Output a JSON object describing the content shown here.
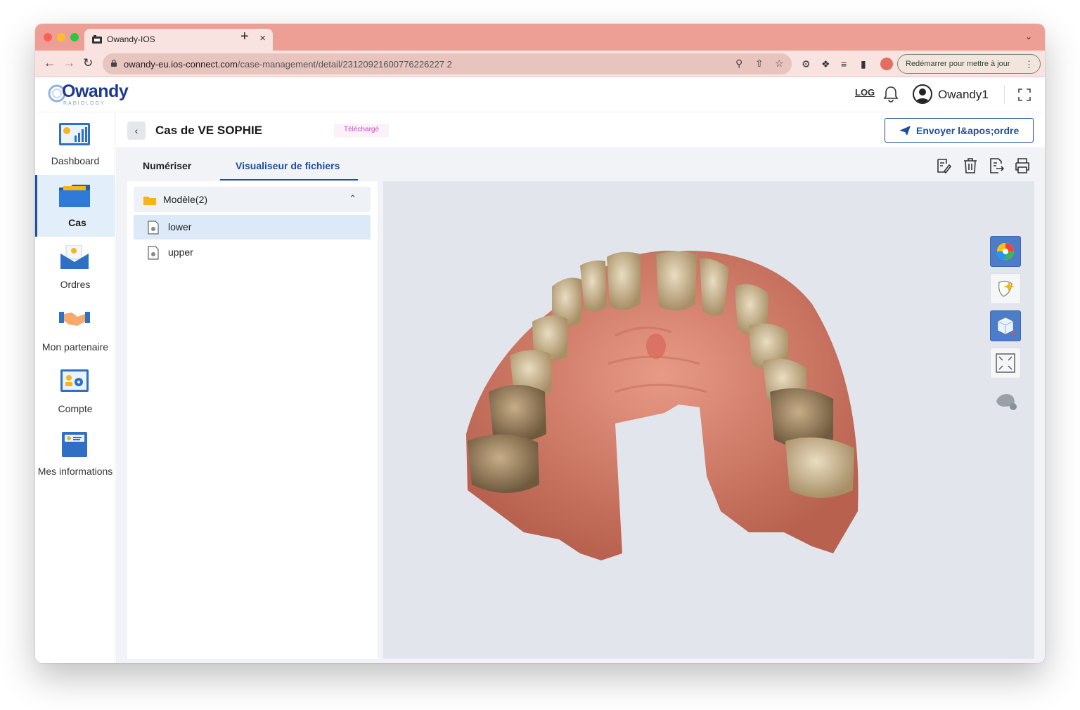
{
  "browser": {
    "tab_title": "Owandy-IOS",
    "tab_close": "×",
    "new_tab": "+",
    "url_host": "owandy-eu.ios-connect.com",
    "url_path": "/case-management/detail/23120921600776226227 2",
    "update_button": "Redémarrer pour mettre à jour"
  },
  "header": {
    "logo": "Owandy",
    "logo_sub": "RADIOLOGY",
    "log_label": "LOG",
    "username": "Owandy1"
  },
  "sidebar": {
    "items": [
      {
        "label": "Dashboard",
        "icon": "dashboard-chart-icon"
      },
      {
        "label": "Cas",
        "icon": "folder-icon"
      },
      {
        "label": "Ordres",
        "icon": "envelope-icon"
      },
      {
        "label": "Mon partenaire",
        "icon": "handshake-icon"
      },
      {
        "label": "Compte",
        "icon": "account-settings-icon"
      },
      {
        "label": "Mes informations",
        "icon": "info-card-icon"
      }
    ]
  },
  "case": {
    "title": "Cas de VE  SOPHIE",
    "status_badge": "Téléchargé",
    "send_button": "Envoyer l&apos;ordre"
  },
  "tabs": [
    {
      "label": "Numériser"
    },
    {
      "label": "Visualiseur de fichiers"
    }
  ],
  "files": {
    "folder_label": "Modèle(2)",
    "items": [
      {
        "label": "lower",
        "selected": true
      },
      {
        "label": "upper",
        "selected": false
      }
    ]
  },
  "viewer": {
    "tools": [
      "color-texture-icon",
      "magic-wand-icon",
      "view-cube-icon",
      "fit-view-icon",
      "scanner-icon"
    ]
  },
  "colors": {
    "brand": "#1d4f9b",
    "chrome_tabbar": "#ee9f95",
    "viewer_bg": "#e2e6ec"
  }
}
